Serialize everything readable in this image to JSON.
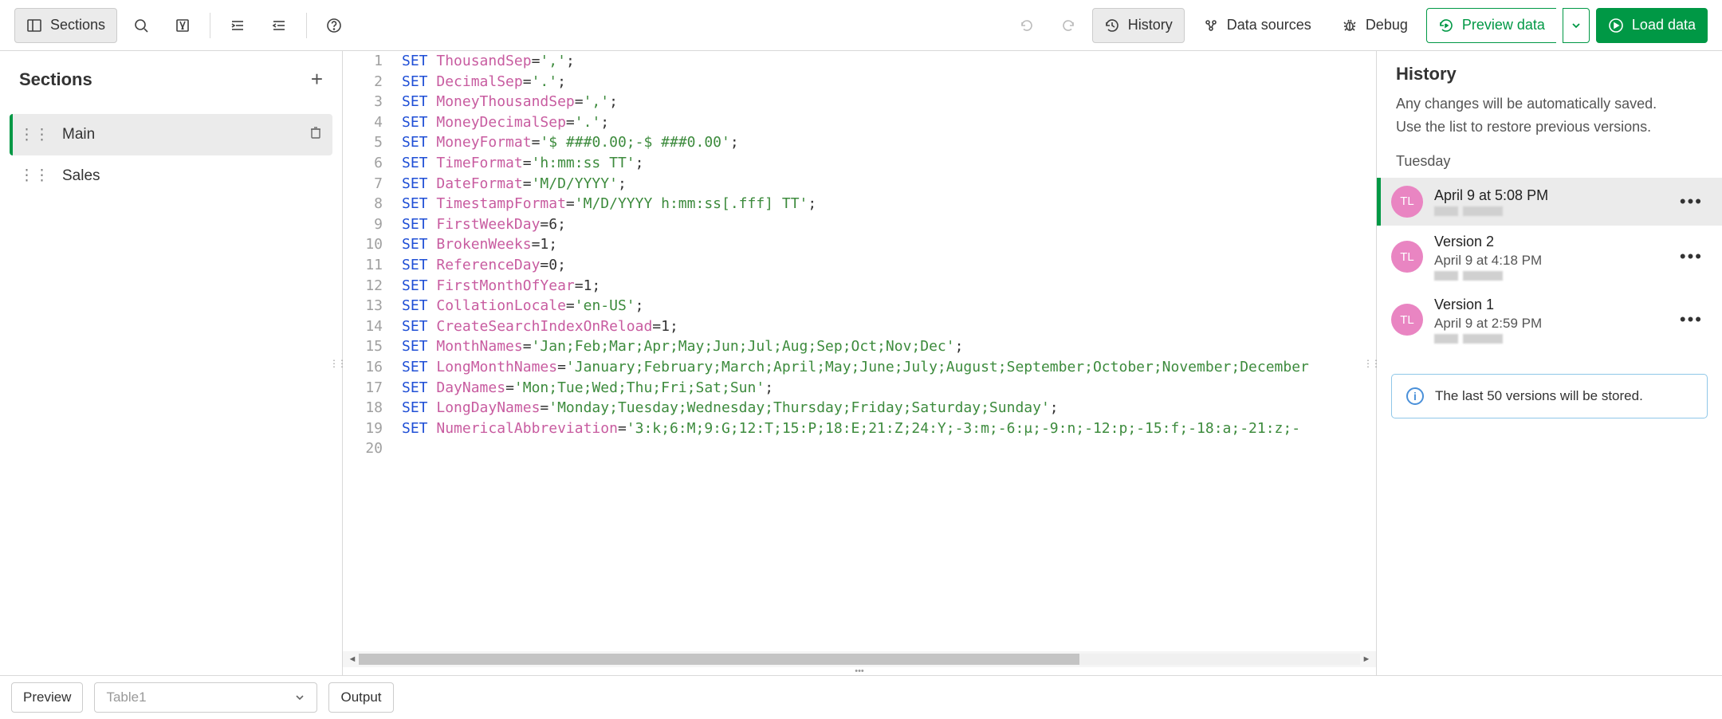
{
  "toolbar": {
    "sections_btn": "Sections",
    "history_btn": "History",
    "data_sources_btn": "Data sources",
    "debug_btn": "Debug",
    "preview_data_btn": "Preview data",
    "load_data_btn": "Load data"
  },
  "sidebar": {
    "title": "Sections",
    "items": [
      {
        "label": "Main",
        "selected": true
      },
      {
        "label": "Sales",
        "selected": false
      }
    ]
  },
  "editor": {
    "lines": [
      {
        "n": 1,
        "kw": "SET",
        "var": "ThousandSep",
        "rest": "=','",
        "term": ";"
      },
      {
        "n": 2,
        "kw": "SET",
        "var": "DecimalSep",
        "rest": "='.'",
        "term": ";"
      },
      {
        "n": 3,
        "kw": "SET",
        "var": "MoneyThousandSep",
        "rest": "=','",
        "term": ";"
      },
      {
        "n": 4,
        "kw": "SET",
        "var": "MoneyDecimalSep",
        "rest": "='.'",
        "term": ";"
      },
      {
        "n": 5,
        "kw": "SET",
        "var": "MoneyFormat",
        "rest": "='$ ###0.00;-$ ###0.00'",
        "term": ";"
      },
      {
        "n": 6,
        "kw": "SET",
        "var": "TimeFormat",
        "rest": "='h:mm:ss TT'",
        "term": ";"
      },
      {
        "n": 7,
        "kw": "SET",
        "var": "DateFormat",
        "rest": "='M/D/YYYY'",
        "term": ";"
      },
      {
        "n": 8,
        "kw": "SET",
        "var": "TimestampFormat",
        "rest": "='M/D/YYYY h:mm:ss[.fff] TT'",
        "term": ";"
      },
      {
        "n": 9,
        "kw": "SET",
        "var": "FirstWeekDay",
        "rest": "=6",
        "term": ";"
      },
      {
        "n": 10,
        "kw": "SET",
        "var": "BrokenWeeks",
        "rest": "=1",
        "term": ";"
      },
      {
        "n": 11,
        "kw": "SET",
        "var": "ReferenceDay",
        "rest": "=0",
        "term": ";"
      },
      {
        "n": 12,
        "kw": "SET",
        "var": "FirstMonthOfYear",
        "rest": "=1",
        "term": ";"
      },
      {
        "n": 13,
        "kw": "SET",
        "var": "CollationLocale",
        "rest": "='en-US'",
        "term": ";"
      },
      {
        "n": 14,
        "kw": "SET",
        "var": "CreateSearchIndexOnReload",
        "rest": "=1",
        "term": ";"
      },
      {
        "n": 15,
        "kw": "SET",
        "var": "MonthNames",
        "rest": "='Jan;Feb;Mar;Apr;May;Jun;Jul;Aug;Sep;Oct;Nov;Dec'",
        "term": ";"
      },
      {
        "n": 16,
        "kw": "SET",
        "var": "LongMonthNames",
        "rest": "='January;February;March;April;May;June;July;August;September;October;November;December",
        "term": ""
      },
      {
        "n": 17,
        "kw": "SET",
        "var": "DayNames",
        "rest": "='Mon;Tue;Wed;Thu;Fri;Sat;Sun'",
        "term": ";"
      },
      {
        "n": 18,
        "kw": "SET",
        "var": "LongDayNames",
        "rest": "='Monday;Tuesday;Wednesday;Thursday;Friday;Saturday;Sunday'",
        "term": ";"
      },
      {
        "n": 19,
        "kw": "SET",
        "var": "NumericalAbbreviation",
        "rest": "='3:k;6:M;9:G;12:T;15:P;18:E;21:Z;24:Y;-3:m;-6:μ;-9:n;-12:p;-15:f;-18:a;-21:z;-",
        "term": ""
      },
      {
        "n": 20,
        "kw": "",
        "var": "",
        "rest": "",
        "term": ""
      }
    ]
  },
  "history": {
    "title": "History",
    "desc1": "Any changes will be automatically saved.",
    "desc2": "Use the list to restore previous versions.",
    "day": "Tuesday",
    "versions": [
      {
        "title": "April 9 at 5:08 PM",
        "sub": "",
        "initials": "TL",
        "selected": true
      },
      {
        "title": "Version 2",
        "sub": "April 9 at 4:18 PM",
        "initials": "TL",
        "selected": false
      },
      {
        "title": "Version 1",
        "sub": "April 9 at 2:59 PM",
        "initials": "TL",
        "selected": false
      }
    ],
    "info": "The last 50 versions will be stored."
  },
  "bottom": {
    "preview": "Preview",
    "table_placeholder": "Table1",
    "output": "Output"
  }
}
